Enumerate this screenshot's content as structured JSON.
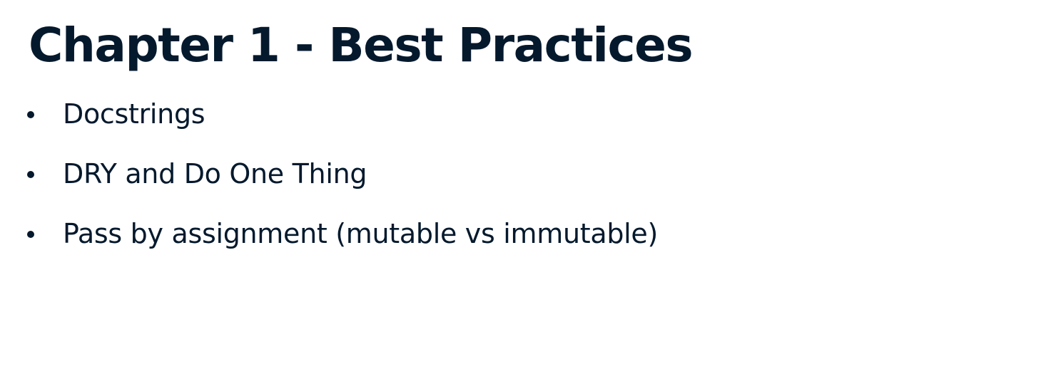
{
  "slide": {
    "title": "Chapter 1 - Best Practices",
    "bullets": [
      "Docstrings",
      "DRY and Do One Thing",
      "Pass by assignment (mutable vs immutable)"
    ],
    "text_color": "#05192d",
    "background_color": "#ffffff"
  }
}
